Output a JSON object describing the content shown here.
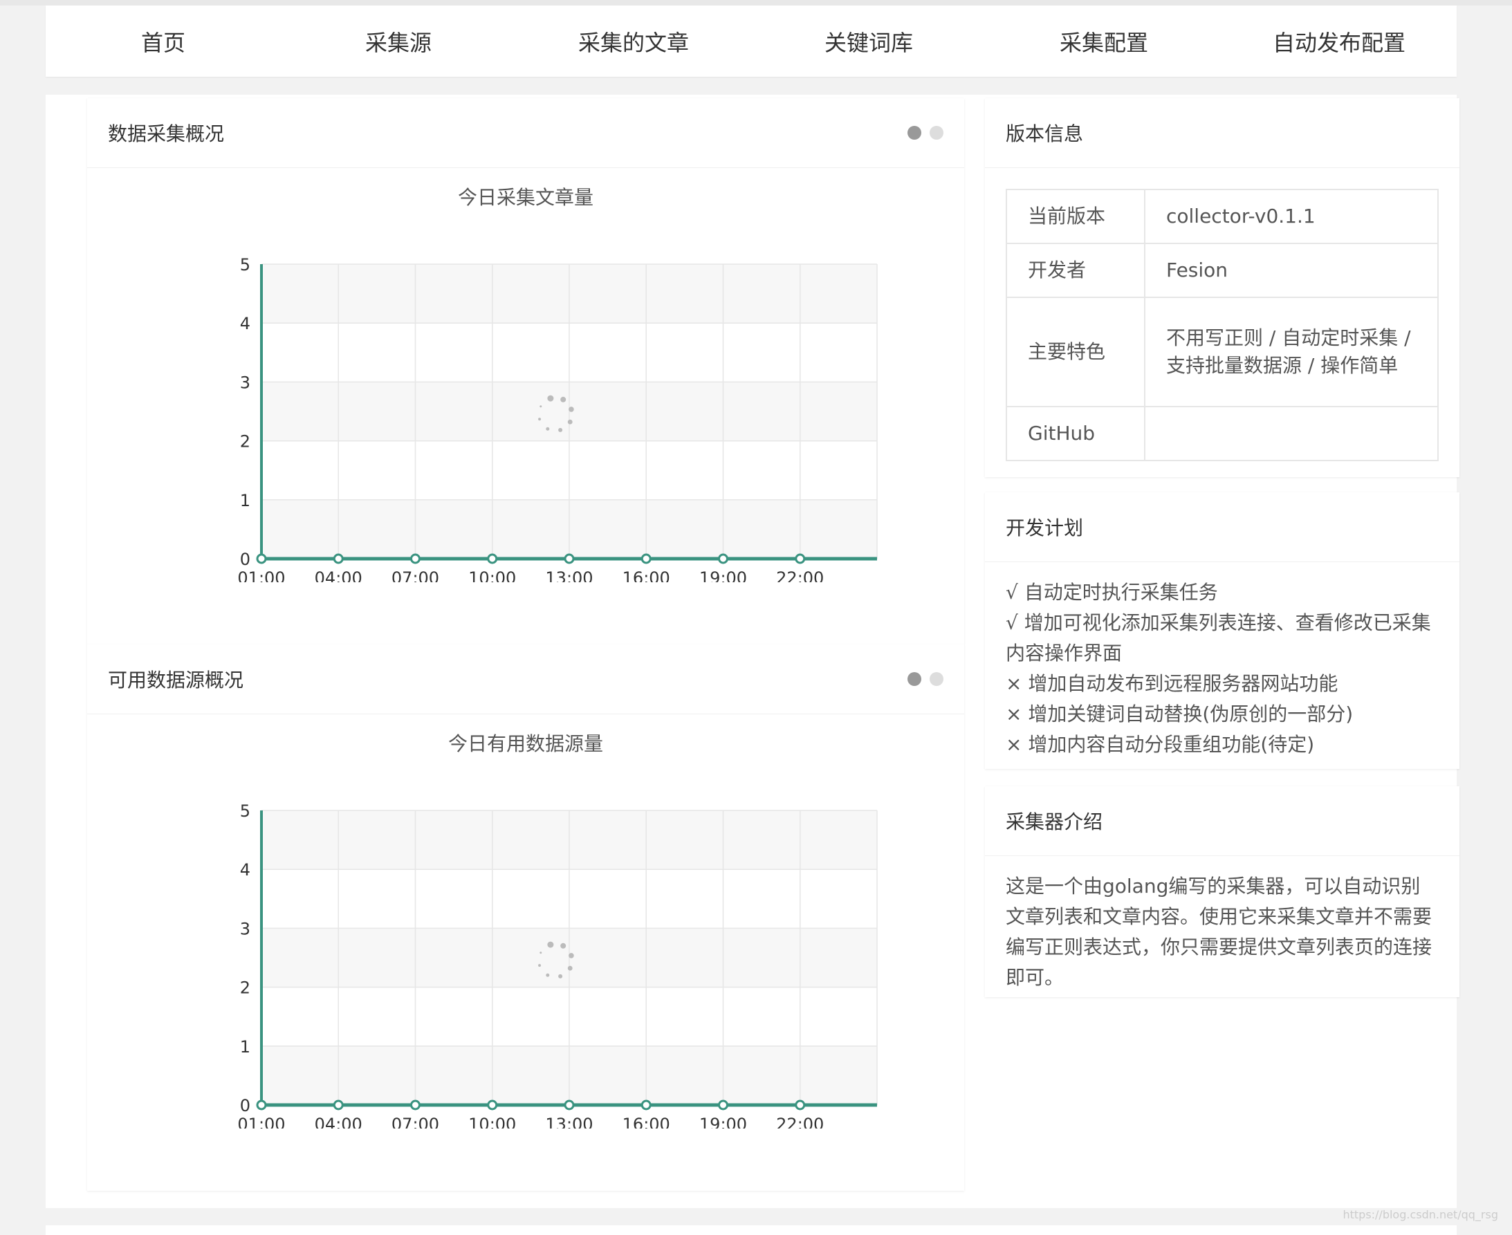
{
  "nav": [
    "首页",
    "采集源",
    "采集的文章",
    "关键词库",
    "采集配置",
    "自动发布配置"
  ],
  "panels": {
    "collect": {
      "title": "数据采集概况",
      "chart_title": "今日采集文章量"
    },
    "sources": {
      "title": "可用数据源概况",
      "chart_title": "今日有用数据源量"
    }
  },
  "version": {
    "title": "版本信息",
    "rows": [
      {
        "k": "当前版本",
        "v": "collector-v0.1.1"
      },
      {
        "k": "开发者",
        "v": "Fesion"
      },
      {
        "k": "主要特色",
        "v": "不用写正则 / 自动定时采集 / 支持批量数据源 / 操作简单"
      },
      {
        "k": "GitHub",
        "v": ""
      }
    ]
  },
  "plan": {
    "title": "开发计划",
    "items": [
      "√ 自动定时执行采集任务",
      "√ 增加可视化添加采集列表连接、查看修改已采集内容操作界面",
      "× 增加自动发布到远程服务器网站功能",
      "× 增加关键词自动替换(伪原创的一部分)",
      "× 增加内容自动分段重组功能(待定)"
    ]
  },
  "intro": {
    "title": "采集器介绍",
    "text": "这是一个由golang编写的采集器，可以自动识别文章列表和文章内容。使用它来采集文章并不需要编写正则表达式，你只需要提供文章列表页的连接即可。"
  },
  "watermark": "https://blog.csdn.net/qq_rsg",
  "colors": {
    "line": "#3a9380",
    "grid_band": "#f7f7f7",
    "grid_line": "#e6e6e6"
  },
  "chart_data": [
    {
      "type": "line",
      "title": "今日采集文章量",
      "categories": [
        "01:00",
        "04:00",
        "07:00",
        "10:00",
        "13:00",
        "16:00",
        "19:00",
        "22:00"
      ],
      "values": [
        0,
        0,
        0,
        0,
        0,
        0,
        0,
        0
      ],
      "ylim": [
        0,
        5
      ],
      "yticks": [
        0,
        1,
        2,
        3,
        4,
        5
      ],
      "grid": true,
      "loading": true
    },
    {
      "type": "line",
      "title": "今日有用数据源量",
      "categories": [
        "01:00",
        "04:00",
        "07:00",
        "10:00",
        "13:00",
        "16:00",
        "19:00",
        "22:00"
      ],
      "values": [
        0,
        0,
        0,
        0,
        0,
        0,
        0,
        0
      ],
      "ylim": [
        0,
        5
      ],
      "yticks": [
        0,
        1,
        2,
        3,
        4,
        5
      ],
      "grid": true,
      "loading": true
    }
  ]
}
